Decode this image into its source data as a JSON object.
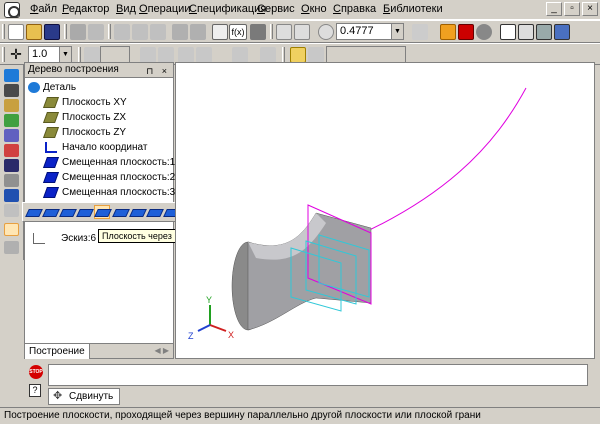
{
  "menu": [
    "Файл",
    "Редактор",
    "Вид",
    "Операции",
    "Спецификация",
    "Сервис",
    "Окно",
    "Справка",
    "Библиотеки"
  ],
  "window_controls": [
    "_",
    "▫",
    "×"
  ],
  "toolbar1": {
    "zoom_value": "0.4777",
    "fx_label": "f(x)"
  },
  "toolbar2": {
    "step_value": "1.0"
  },
  "tree": {
    "title": "Дерево построения",
    "header_buttons": "⊓ ×",
    "items": [
      {
        "label": "Деталь",
        "icon": "part-icon"
      },
      {
        "label": "Плоскость XY",
        "icon": "plane-icon"
      },
      {
        "label": "Плоскость ZX",
        "icon": "plane-icon"
      },
      {
        "label": "Плоскость ZY",
        "icon": "plane-icon"
      },
      {
        "label": "Начало координат",
        "icon": "origin-icon"
      },
      {
        "label": "Смещенная плоскость:1",
        "icon": "offset-plane-icon"
      },
      {
        "label": "Смещенная плоскость:2",
        "icon": "offset-plane-icon"
      },
      {
        "label": "Смещенная плоскость:3",
        "icon": "offset-plane-icon"
      },
      {
        "label": "Эскиз:6",
        "icon": "sketch-icon"
      }
    ],
    "tab_label": "Построение",
    "tab_arrows": "◀ ▶"
  },
  "popup_toolbar": {
    "active_index": 6
  },
  "tooltip": "Плоскость через вершину параллельно другой плоскости",
  "axes": {
    "x": "X",
    "y": "Y",
    "z": "Z"
  },
  "bottom": {
    "stop_label": "STOP",
    "help_label": "?",
    "shift_label": "Сдвинуть"
  },
  "status_text": "Построение плоскости, проходящей через вершину параллельно другой плоскости или плоской грани",
  "colors": {
    "accent_olive": "#8a8a3a",
    "accent_blue": "#0a22c8",
    "curve_magenta": "#e000e0",
    "sketch_cyan": "#30c8d8"
  }
}
